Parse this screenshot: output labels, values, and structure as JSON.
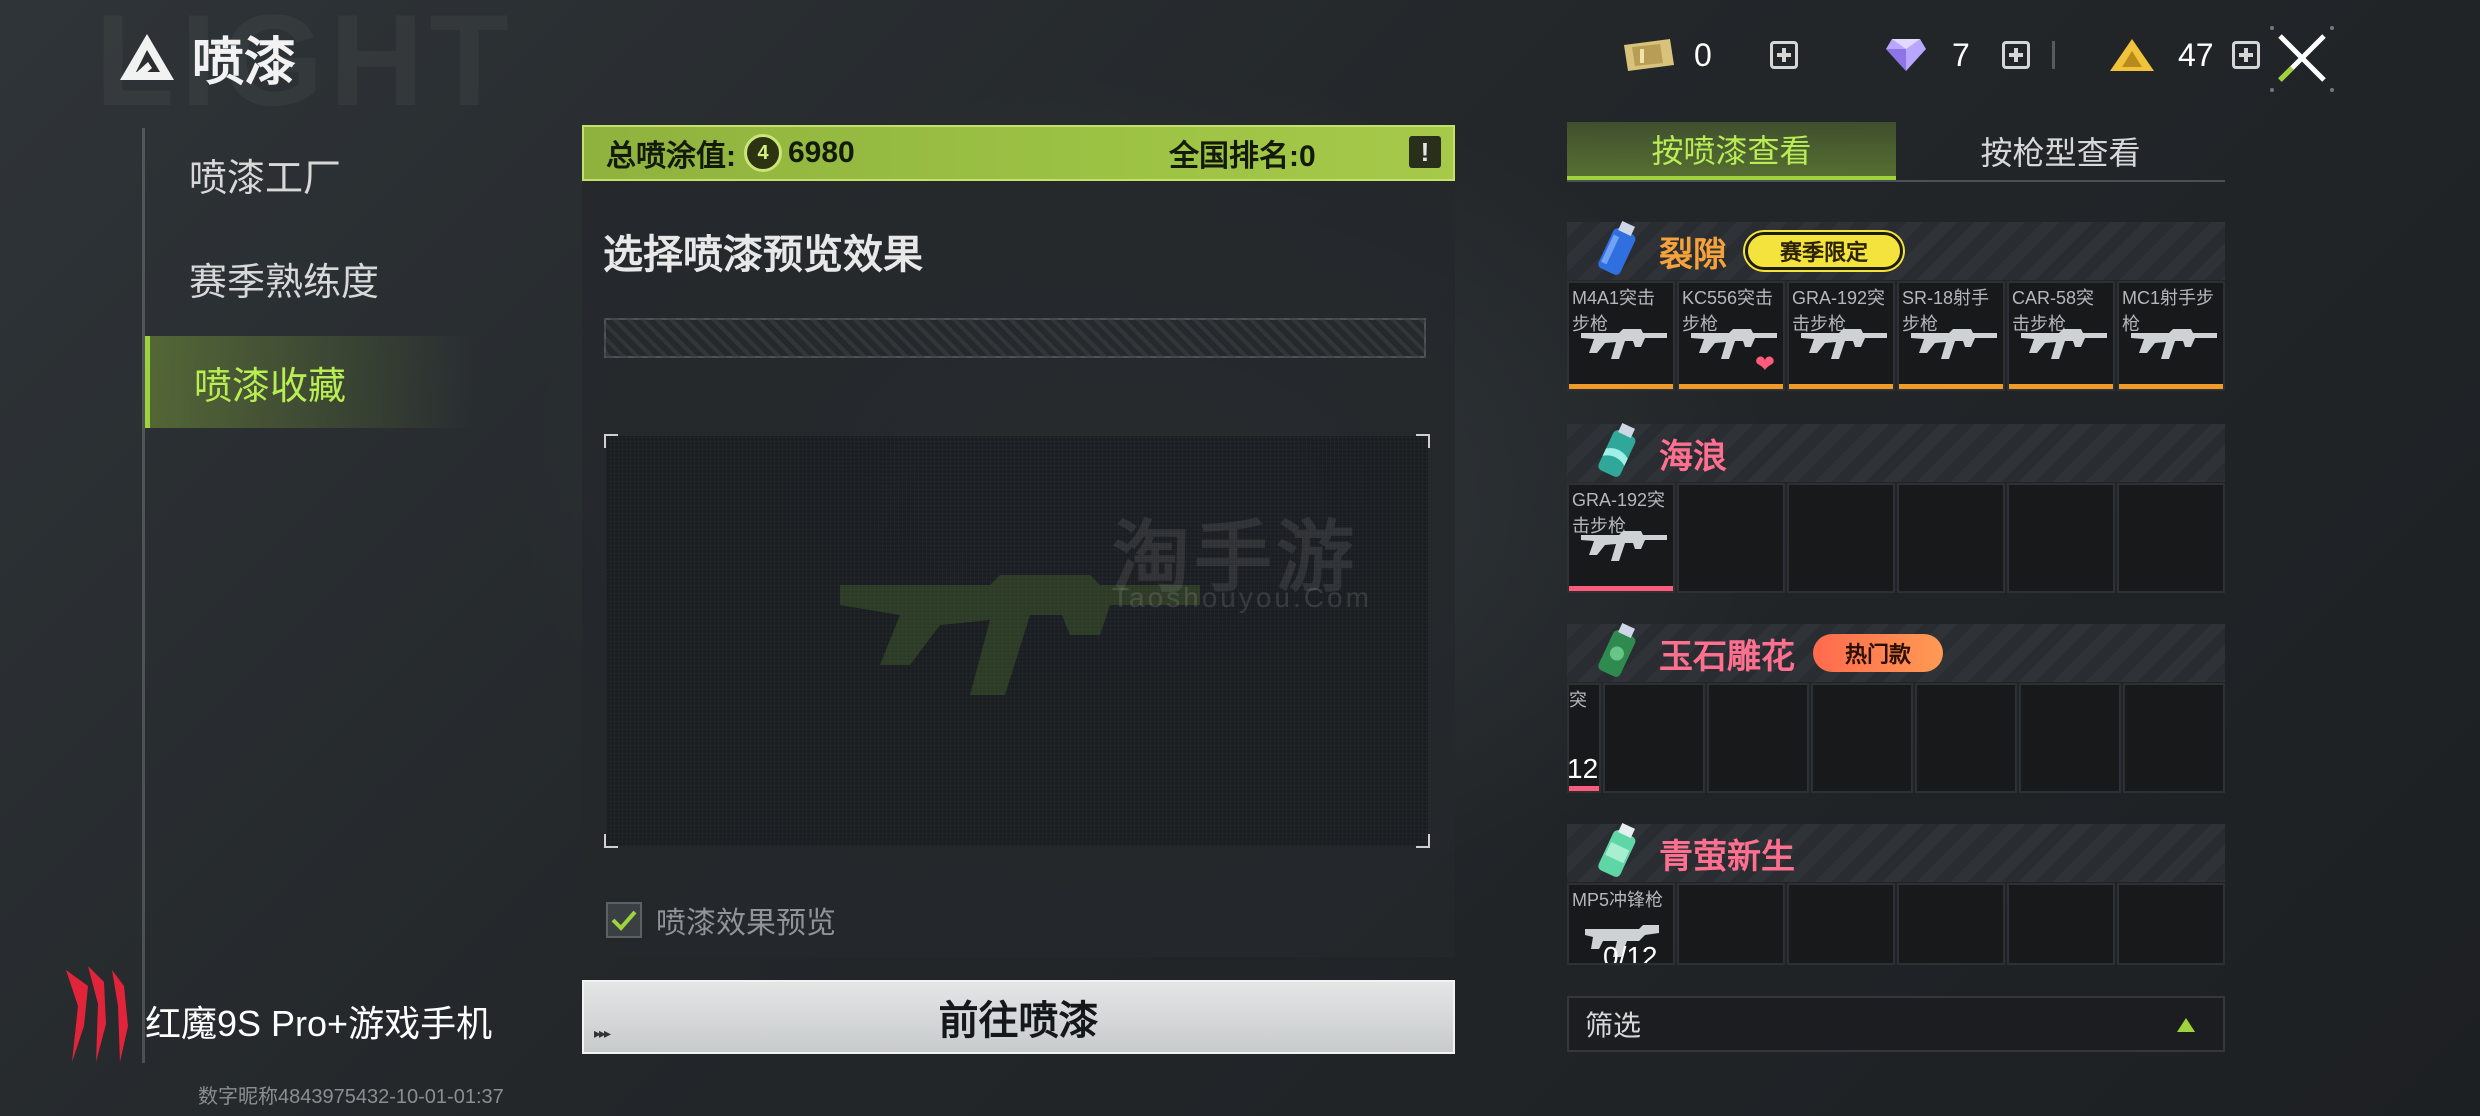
{
  "header": {
    "bg_word": "LIGHT",
    "title": "喷漆",
    "currencies": [
      {
        "icon": "ticket-icon",
        "value": "0"
      },
      {
        "icon": "diamond-icon",
        "value": "7"
      },
      {
        "icon": "triangle-coin-icon",
        "value": "47"
      }
    ]
  },
  "nav": {
    "items": [
      {
        "label": "喷漆工厂",
        "active": false
      },
      {
        "label": "赛季熟练度",
        "active": false
      },
      {
        "label": "喷漆收藏",
        "active": true
      }
    ]
  },
  "brand": {
    "text": "红魔9S Pro+游戏手机",
    "stamp": "数字昵称4843975432-10-01-01:37"
  },
  "score": {
    "label": "总喷涂值:",
    "coin_glyph": "4",
    "value": "6980",
    "rank": "全国排名:0",
    "info_glyph": "!"
  },
  "preview": {
    "title": "选择喷漆预览效果",
    "watermark": "淘手游",
    "watermark_sub": "Taoshouyou.Com",
    "checkbox_label": "喷漆效果预览",
    "checked": true
  },
  "action": {
    "go_label": "前往喷漆",
    "arrows": "▸▸▸"
  },
  "tabs": [
    {
      "label": "按喷漆查看",
      "active": true
    },
    {
      "label": "按枪型查看",
      "active": false
    }
  ],
  "groups": [
    {
      "name": "裂隙",
      "name_color": "#f5a23a",
      "can_color": "#2f6fe0",
      "badge": "赛季限定",
      "badge_type": "season",
      "bar_color": "#f09a2a",
      "cells": [
        {
          "name": "M4A1突击步枪"
        },
        {
          "name": "KC556突击步枪",
          "heart": "❤"
        },
        {
          "name": "GRA-192突击步枪"
        },
        {
          "name": "SR-18射手步枪"
        },
        {
          "name": "CAR-58突击步枪"
        },
        {
          "name": "MC1射手步枪"
        }
      ]
    },
    {
      "name": "海浪",
      "name_color": "#ff6f8f",
      "can_color": "#3fbfb0",
      "badge": "",
      "bar_color": "#ff5b7a",
      "cells": [
        {
          "name": "GRA-192突击步枪"
        }
      ]
    },
    {
      "name": "玉石雕花",
      "name_color": "#ff6f8f",
      "can_color": "#3aa35d",
      "badge": "热门款",
      "badge_type": "hot",
      "bar_color": "#ff5b7a",
      "cells": [
        {
          "name": "突",
          "count": "12",
          "partial": true
        }
      ]
    },
    {
      "name": "青萤新生",
      "name_color": "#ff6f8f",
      "can_color": "#6ee0b0",
      "badge": "",
      "bar_color": "#ff5b7a",
      "cells": [
        {
          "name": "MP5冲锋枪",
          "count": "0/12"
        }
      ]
    }
  ],
  "filter": {
    "label": "筛选"
  }
}
